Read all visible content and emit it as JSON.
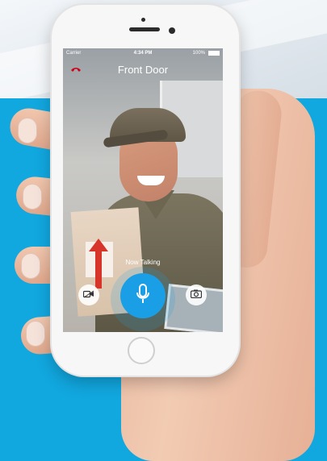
{
  "status_bar": {
    "carrier": "Carrier",
    "time": "4:34 PM",
    "battery": "100%"
  },
  "header": {
    "title": "Front Door",
    "hangup_icon": "phone-hangup-icon",
    "hangup_color": "#d0021b"
  },
  "controls": {
    "status_text": "Now Talking",
    "mic_icon": "microphone-icon",
    "video_icon": "video-camera-icon",
    "snapshot_icon": "camera-icon",
    "accent_color": "#1a9fe6"
  },
  "colors": {
    "background_blue": "#11a7df"
  }
}
